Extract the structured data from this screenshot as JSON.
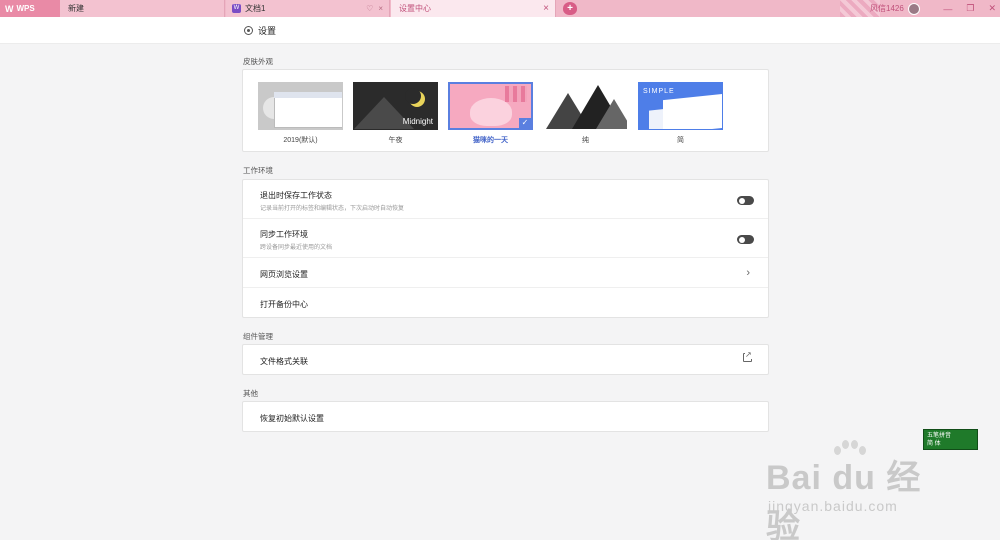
{
  "tabs": {
    "logo": "WPS",
    "new_tab": "新建",
    "doc_tab": "文档1",
    "settings_tab": "设置中心",
    "user_name": "风信1426"
  },
  "header": {
    "title": "设置"
  },
  "skin_section": {
    "label": "皮肤外观",
    "skins": [
      {
        "caption": "2019(默认)"
      },
      {
        "caption": "午夜",
        "thumb_text": "Midnight"
      },
      {
        "caption": "猫咪的一天",
        "selected": true
      },
      {
        "caption": "纯"
      },
      {
        "caption": "简",
        "thumb_text": "SIMPLE"
      }
    ]
  },
  "work_section": {
    "label": "工作环境",
    "rows": [
      {
        "title": "退出时保存工作状态",
        "desc": "记录当前打开的标签和编辑状态，下次启动时自动恢复",
        "control": "toggle",
        "on": false
      },
      {
        "title": "同步工作环境",
        "desc": "跨设备同步最近使用的文档",
        "control": "toggle",
        "on": false
      },
      {
        "title": "网页浏览设置",
        "control": "chevron-right"
      },
      {
        "title": "打开备份中心"
      }
    ]
  },
  "plugin_section": {
    "label": "组件管理",
    "rows": [
      {
        "title": "文件格式关联",
        "control": "external-link"
      }
    ]
  },
  "other_section": {
    "label": "其他",
    "rows": [
      {
        "title": "恢复初始默认设置"
      }
    ]
  },
  "ime": {
    "line1": "五笔拼音",
    "line2": "简 体"
  },
  "watermark": {
    "brand": "Bai du 经验",
    "url": "jingyan.baidu.com"
  },
  "colors": {
    "accent": "#5a7fe0",
    "tabbar": "#f0b8c8",
    "selected_tab_text": "#c0507a"
  }
}
